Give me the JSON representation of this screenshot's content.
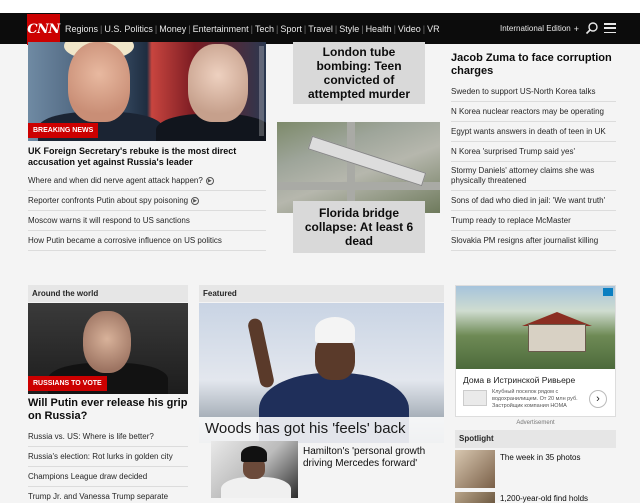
{
  "nav": {
    "logo": "CNN",
    "links": [
      "Regions",
      "U.S. Politics",
      "Money",
      "Entertainment",
      "Tech",
      "Sport",
      "Travel",
      "Style",
      "Health",
      "Video",
      "VR"
    ],
    "edition": "International Edition",
    "edition_plus": "+"
  },
  "col1": {
    "badge": "BREAKING NEWS",
    "headline": "UK Foreign Secretary's rebuke is the most direct accusation yet against Russia's leader",
    "links": [
      "Where and when did nerve agent attack happen?",
      "Reporter confronts Putin about spy poisoning",
      "Moscow warns it will respond to US sanctions",
      "How Putin became a corrosive influence on US politics"
    ]
  },
  "col2": {
    "tube_headline": "London tube bombing: Teen convicted of attempted murder",
    "bridge_headline": "Florida bridge collapse: At least 6 dead"
  },
  "col3": {
    "headline": "Jacob Zuma to face corruption charges",
    "links": [
      "Sweden to support US-North Korea talks",
      "N Korea nuclear reactors may be operating",
      "Egypt wants answers in death of teen in UK",
      "N Korea 'surprised Trump said yes'",
      "Stormy Daniels' attorney claims she was physically threatened",
      "Sons of dad who died in jail: 'We want truth'",
      "Trump ready to replace McMaster",
      "Slovakia PM resigns after journalist killing"
    ]
  },
  "around": {
    "header": "Around the world",
    "badge": "RUSSIANS TO VOTE",
    "headline": "Will Putin ever release his grip on Russia?",
    "links": [
      "Russia vs. US: Where is life better?",
      "Russia's election: Rot lurks in golden city",
      "Champions League draw decided",
      "Trump Jr. and Vanessa Trump separate"
    ]
  },
  "featured": {
    "header": "Featured",
    "overlay": "Woods has got his 'feels' back",
    "sub_headline": "Hamilton's 'personal growth driving Mercedes forward'"
  },
  "ad": {
    "title": "Дома в Истринской Ривьере",
    "sub": "Клубный поселок рядом с водохранилищем. От 20 млн руб. Застройщик компания НОМА",
    "arrow": "›",
    "label": "Advertisement"
  },
  "spotlight": {
    "header": "Spotlight",
    "items": [
      "The week in 35 photos",
      "1,200-year-old find holds"
    ]
  }
}
